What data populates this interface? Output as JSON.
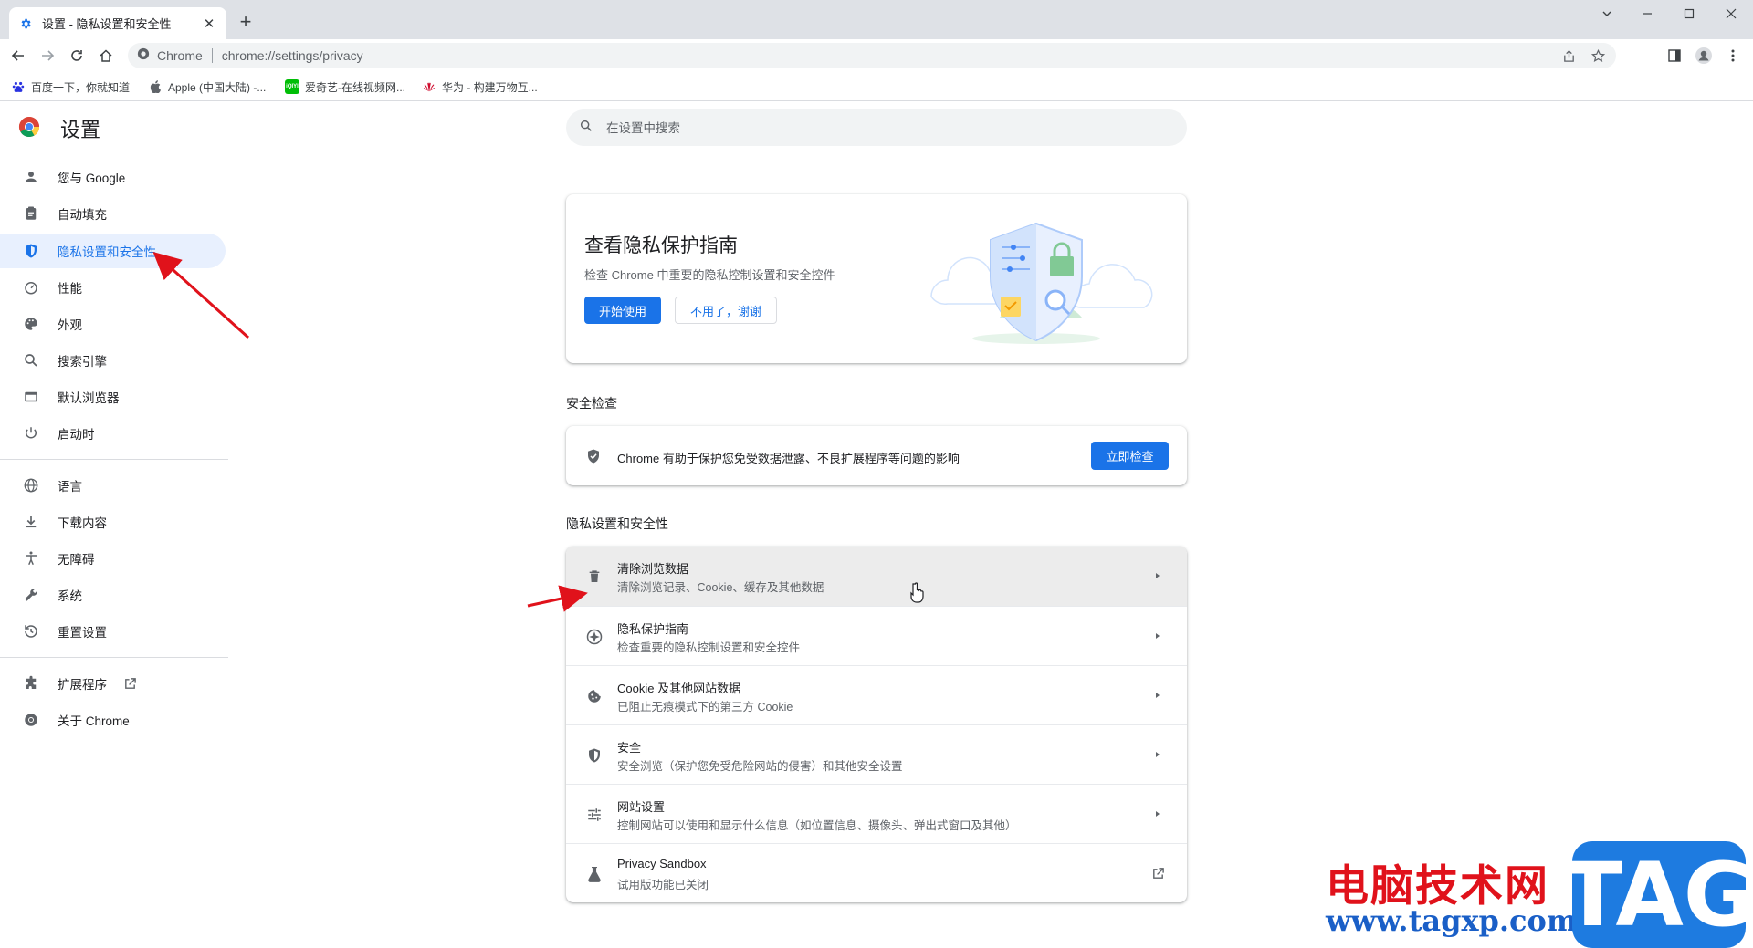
{
  "browser": {
    "tab_title": "设置 - 隐私设置和安全性",
    "tab_close": "✕",
    "new_tab": "+",
    "site_label": "Chrome",
    "url": "chrome://settings/privacy"
  },
  "bookmarks": [
    {
      "label": "百度一下，你就知道",
      "icon": "baidu-icon"
    },
    {
      "label": "Apple (中国大陆) -...",
      "icon": "apple-icon"
    },
    {
      "label": "爱奇艺-在线视频网...",
      "icon": "iqiyi-icon"
    },
    {
      "label": "华为 - 构建万物互...",
      "icon": "huawei-icon"
    }
  ],
  "iqiyi_glyph": "iQIYI",
  "settings": {
    "title": "设置",
    "search_placeholder": "在设置中搜索"
  },
  "sidebar": {
    "items": [
      {
        "label": "您与 Google",
        "icon": "person-icon"
      },
      {
        "label": "自动填充",
        "icon": "clipboard-icon"
      },
      {
        "label": "隐私设置和安全性",
        "icon": "shield-icon",
        "active": true
      },
      {
        "label": "性能",
        "icon": "speedometer-icon"
      },
      {
        "label": "外观",
        "icon": "palette-icon"
      },
      {
        "label": "搜索引擎",
        "icon": "search-icon"
      },
      {
        "label": "默认浏览器",
        "icon": "browser-icon"
      },
      {
        "label": "启动时",
        "icon": "power-icon"
      },
      {
        "label": "语言",
        "icon": "globe-icon"
      },
      {
        "label": "下载内容",
        "icon": "download-icon"
      },
      {
        "label": "无障碍",
        "icon": "accessibility-icon"
      },
      {
        "label": "系统",
        "icon": "wrench-icon"
      },
      {
        "label": "重置设置",
        "icon": "history-icon"
      },
      {
        "label": "扩展程序",
        "icon": "puzzle-icon"
      },
      {
        "label": "关于 Chrome",
        "icon": "chrome-icon"
      }
    ]
  },
  "privacy_guide": {
    "title": "查看隐私保护指南",
    "subtitle": "检查 Chrome 中重要的隐私控制设置和安全控件",
    "start_label": "开始使用",
    "dismiss_label": "不用了，谢谢"
  },
  "safety_check": {
    "heading": "安全检查",
    "text": "Chrome 有助于保护您免受数据泄露、不良扩展程序等问题的影响",
    "button_label": "立即检查"
  },
  "privacy_section": {
    "heading": "隐私设置和安全性",
    "rows": [
      {
        "title": "清除浏览数据",
        "subtitle": "清除浏览记录、Cookie、缓存及其他数据",
        "icon": "trash-icon",
        "action": "arrow"
      },
      {
        "title": "隐私保护指南",
        "subtitle": "检查重要的隐私控制设置和安全控件",
        "icon": "compass-icon",
        "action": "arrow"
      },
      {
        "title": "Cookie 及其他网站数据",
        "subtitle": "已阻止无痕模式下的第三方 Cookie",
        "icon": "cookie-icon",
        "action": "arrow"
      },
      {
        "title": "安全",
        "subtitle": "安全浏览（保护您免受危险网站的侵害）和其他安全设置",
        "icon": "shield-icon",
        "action": "arrow"
      },
      {
        "title": "网站设置",
        "subtitle": "控制网站可以使用和显示什么信息（如位置信息、摄像头、弹出式窗口及其他）",
        "icon": "tune-icon",
        "action": "arrow"
      },
      {
        "title": "Privacy Sandbox",
        "subtitle": "试用版功能已关闭",
        "icon": "flask-icon",
        "action": "external"
      }
    ]
  },
  "watermark": {
    "brand": "电脑技术网",
    "url": "www.tagxp.com",
    "badge": "TAG"
  },
  "colors": {
    "accent": "#1a73e8",
    "active_bg": "#e8f0fe",
    "annotation_arrow": "#e0121b",
    "watermark_red": "#e0121b",
    "watermark_blue": "#1e7be0"
  }
}
